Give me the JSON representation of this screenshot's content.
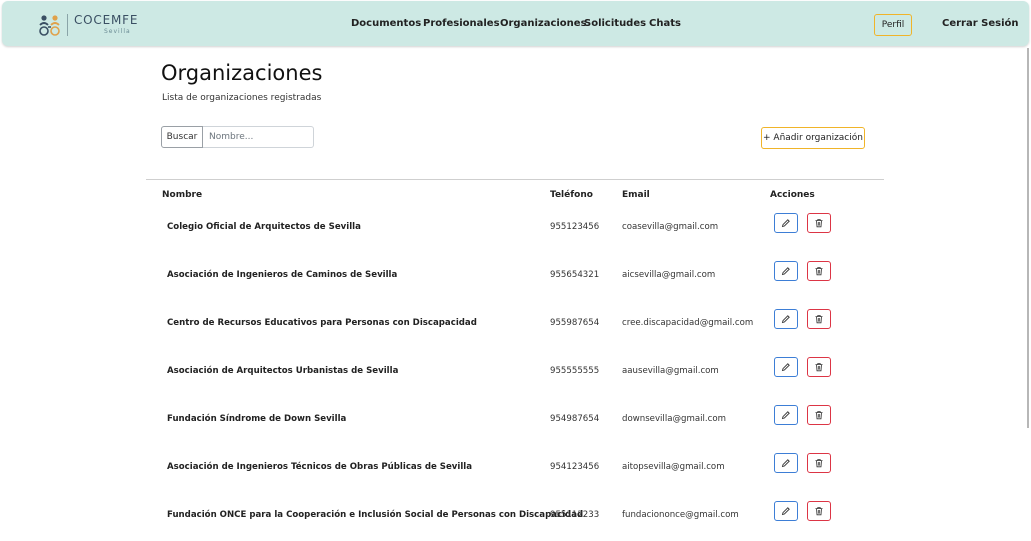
{
  "brand": {
    "name": "COCEMFE",
    "sub": "Sevilla"
  },
  "nav": {
    "documentos": "Documentos",
    "profesionales": "Profesionales",
    "organizaciones": "Organizaciones",
    "solicitudes": "Solicitudes",
    "chats": "Chats",
    "perfil": "Perfil",
    "cerrar_sesion": "Cerrar Sesión"
  },
  "page": {
    "title": "Organizaciones",
    "subtitle": "Lista de organizaciones registradas"
  },
  "search": {
    "button_label": "Buscar",
    "placeholder": "Nombre...",
    "value": ""
  },
  "add_button_label": "+ Añadir organización",
  "table": {
    "headers": {
      "nombre": "Nombre",
      "telefono": "Teléfono",
      "email": "Email",
      "acciones": "Acciones"
    },
    "rows": [
      {
        "nombre": "Colegio Oficial de Arquitectos de Sevilla",
        "telefono": "955123456",
        "email": "coasevilla@gmail.com"
      },
      {
        "nombre": "Asociación de Ingenieros de Caminos de Sevilla",
        "telefono": "955654321",
        "email": "aicsevilla@gmail.com"
      },
      {
        "nombre": "Centro de Recursos Educativos para Personas con Discapacidad",
        "telefono": "955987654",
        "email": "cree.discapacidad@gmail.com"
      },
      {
        "nombre": "Asociación de Arquitectos Urbanistas de Sevilla",
        "telefono": "955555555",
        "email": "aausevilla@gmail.com"
      },
      {
        "nombre": "Fundación Síndrome de Down Sevilla",
        "telefono": "954987654",
        "email": "downsevilla@gmail.com"
      },
      {
        "nombre": "Asociación de Ingenieros Técnicos de Obras Públicas de Sevilla",
        "telefono": "954123456",
        "email": "aitopsevilla@gmail.com"
      },
      {
        "nombre": "Fundación ONCE para la Cooperación e Inclusión Social de Personas con Discapacidad",
        "telefono": "955112233",
        "email": "fundaciononce@gmail.com"
      }
    ]
  },
  "icons": {
    "edit": "pencil-icon",
    "delete": "trash-icon"
  },
  "colors": {
    "navbar_bg": "#cde9e4",
    "accent": "#f0b429",
    "edit": "#3d7ed6",
    "delete": "#dc3545"
  }
}
